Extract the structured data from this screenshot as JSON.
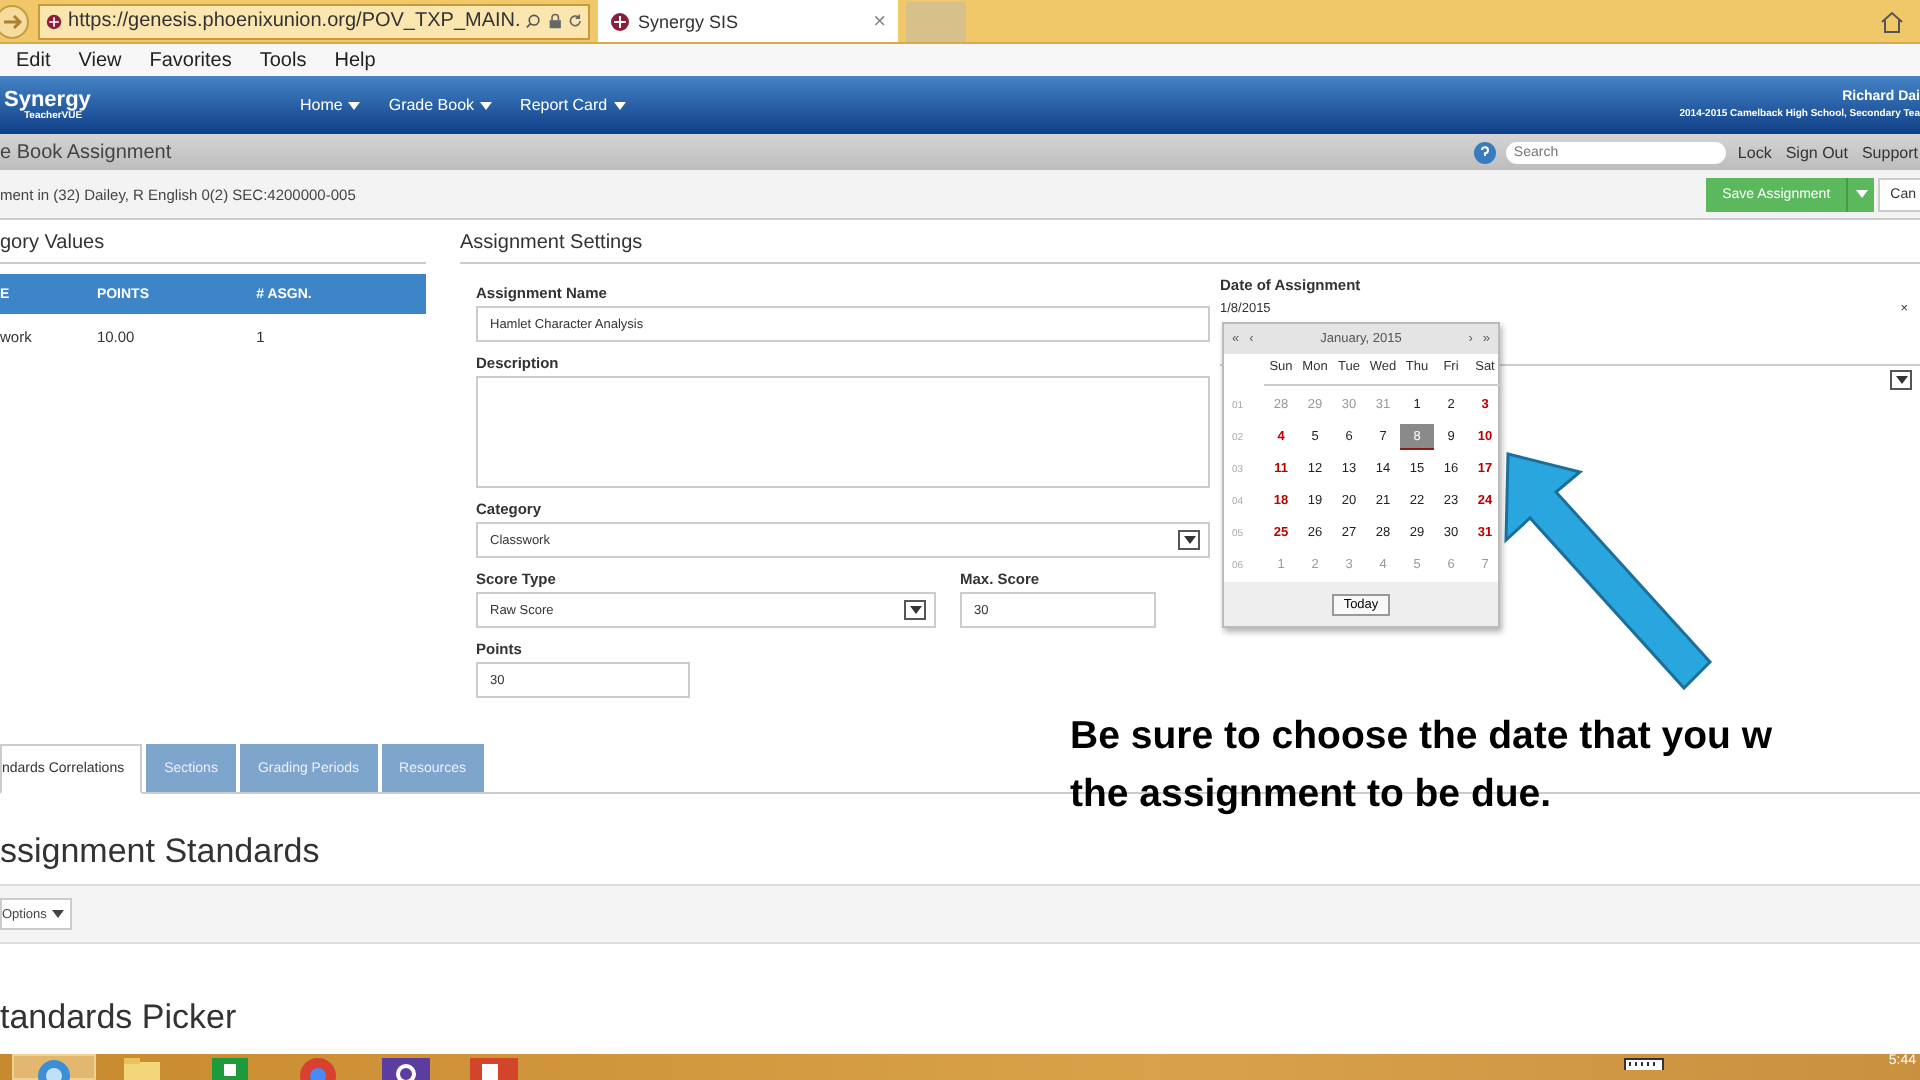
{
  "browser": {
    "url": "https://genesis.phoenixunion.org/POV_TXP_MAIN.",
    "tab": {
      "title": "Synergy SIS",
      "close": "×"
    }
  },
  "menu_bar": [
    "Edit",
    "View",
    "Favorites",
    "Tools",
    "Help"
  ],
  "app_header": {
    "logo": "Synergy",
    "logo_subtitle": "TeacherVUE",
    "nav": [
      "Home",
      "Grade Book",
      "Report Card"
    ],
    "user_name": "Richard Dai",
    "user_detail": "2014-2015 Camelback High School, Secondary Tea"
  },
  "page_bar": {
    "title": "e Book Assignment",
    "search": {
      "placeholder": "Search"
    },
    "links": [
      "Lock",
      "Sign Out",
      "Support"
    ]
  },
  "context_bar": {
    "text": "ment in (32) Dailey, R English 0(2) SEC:4200000-005",
    "save_button": "Save Assignment",
    "cancel_button": "Can"
  },
  "category_values": {
    "title": "gory Values",
    "columns": [
      "E",
      "POINTS",
      "# ASGN."
    ],
    "rows": [
      [
        "work",
        "10.00",
        "1"
      ]
    ]
  },
  "assignment_settings": {
    "title": "Assignment Settings",
    "assignment_name": {
      "label": "Assignment Name",
      "value": "Hamlet Character Analysis"
    },
    "description": {
      "label": "Description"
    },
    "category": {
      "label": "Category",
      "value": "Classwork"
    },
    "score_type": {
      "label": "Score Type",
      "value": "Raw Score"
    },
    "max_score": {
      "label": "Max. Score",
      "value": "30"
    },
    "points": {
      "label": "Points",
      "value": "30"
    },
    "date": {
      "label": "Date of Assignment",
      "value": "1/8/2015",
      "clear": "×"
    }
  },
  "calendar": {
    "month": "January, 2015",
    "nav": [
      "«",
      "‹",
      "›",
      "»"
    ],
    "weekdays": [
      "Sun",
      "Mon",
      "Tue",
      "Wed",
      "Thu",
      "Fri",
      "Sat"
    ],
    "weeks": [
      {
        "number": "01",
        "days": [
          {
            "n": "28",
            "muted": true,
            "weekend": false,
            "selected": false
          },
          {
            "n": "29",
            "muted": true,
            "weekend": false,
            "selected": false
          },
          {
            "n": "30",
            "muted": true,
            "weekend": false,
            "selected": false
          },
          {
            "n": "31",
            "muted": true,
            "weekend": false,
            "selected": false
          },
          {
            "n": "1",
            "muted": false,
            "weekend": false,
            "selected": false
          },
          {
            "n": "2",
            "muted": false,
            "weekend": false,
            "selected": false
          },
          {
            "n": "3",
            "muted": false,
            "weekend": true,
            "selected": false
          }
        ]
      },
      {
        "number": "02",
        "days": [
          {
            "n": "4",
            "muted": false,
            "weekend": true,
            "selected": false
          },
          {
            "n": "5",
            "muted": false,
            "weekend": false,
            "selected": false
          },
          {
            "n": "6",
            "muted": false,
            "weekend": false,
            "selected": false
          },
          {
            "n": "7",
            "muted": false,
            "weekend": false,
            "selected": false
          },
          {
            "n": "8",
            "muted": false,
            "weekend": false,
            "selected": true
          },
          {
            "n": "9",
            "muted": false,
            "weekend": false,
            "selected": false
          },
          {
            "n": "10",
            "muted": false,
            "weekend": true,
            "selected": false
          }
        ]
      },
      {
        "number": "03",
        "days": [
          {
            "n": "11",
            "muted": false,
            "weekend": true,
            "selected": false
          },
          {
            "n": "12",
            "muted": false,
            "weekend": false,
            "selected": false
          },
          {
            "n": "13",
            "muted": false,
            "weekend": false,
            "selected": false
          },
          {
            "n": "14",
            "muted": false,
            "weekend": false,
            "selected": false
          },
          {
            "n": "15",
            "muted": false,
            "weekend": false,
            "selected": false
          },
          {
            "n": "16",
            "muted": false,
            "weekend": false,
            "selected": false
          },
          {
            "n": "17",
            "muted": false,
            "weekend": true,
            "selected": false
          }
        ]
      },
      {
        "number": "04",
        "days": [
          {
            "n": "18",
            "muted": false,
            "weekend": true,
            "selected": false
          },
          {
            "n": "19",
            "muted": false,
            "weekend": false,
            "selected": false
          },
          {
            "n": "20",
            "muted": false,
            "weekend": false,
            "selected": false
          },
          {
            "n": "21",
            "muted": false,
            "weekend": false,
            "selected": false
          },
          {
            "n": "22",
            "muted": false,
            "weekend": false,
            "selected": false
          },
          {
            "n": "23",
            "muted": false,
            "weekend": false,
            "selected": false
          },
          {
            "n": "24",
            "muted": false,
            "weekend": true,
            "selected": false
          }
        ]
      },
      {
        "number": "05",
        "days": [
          {
            "n": "25",
            "muted": false,
            "weekend": true,
            "selected": false
          },
          {
            "n": "26",
            "muted": false,
            "weekend": false,
            "selected": false
          },
          {
            "n": "27",
            "muted": false,
            "weekend": false,
            "selected": false
          },
          {
            "n": "28",
            "muted": false,
            "weekend": false,
            "selected": false
          },
          {
            "n": "29",
            "muted": false,
            "weekend": false,
            "selected": false
          },
          {
            "n": "30",
            "muted": false,
            "weekend": false,
            "selected": false
          },
          {
            "n": "31",
            "muted": false,
            "weekend": true,
            "selected": false
          }
        ]
      },
      {
        "number": "06",
        "days": [
          {
            "n": "1",
            "muted": true,
            "weekend": false,
            "selected": false
          },
          {
            "n": "2",
            "muted": true,
            "weekend": false,
            "selected": false
          },
          {
            "n": "3",
            "muted": true,
            "weekend": false,
            "selected": false
          },
          {
            "n": "4",
            "muted": true,
            "weekend": false,
            "selected": false
          },
          {
            "n": "5",
            "muted": true,
            "weekend": false,
            "selected": false
          },
          {
            "n": "6",
            "muted": true,
            "weekend": false,
            "selected": false
          },
          {
            "n": "7",
            "muted": true,
            "weekend": false,
            "selected": false
          }
        ]
      }
    ],
    "today_button": "Today"
  },
  "tabs": [
    {
      "label": "ndards Correlations",
      "selected": true
    },
    {
      "label": "Sections",
      "selected": false
    },
    {
      "label": "Grading Periods",
      "selected": false
    },
    {
      "label": "Resources",
      "selected": false
    }
  ],
  "standards": {
    "heading": "ssignment Standards",
    "options_button": "Options",
    "picker_heading": "tandards Picker"
  },
  "annotation": {
    "text": "Be sure to choose the date that you w\nthe assignment to be due."
  },
  "taskbar": {
    "clock": "5:44"
  }
}
